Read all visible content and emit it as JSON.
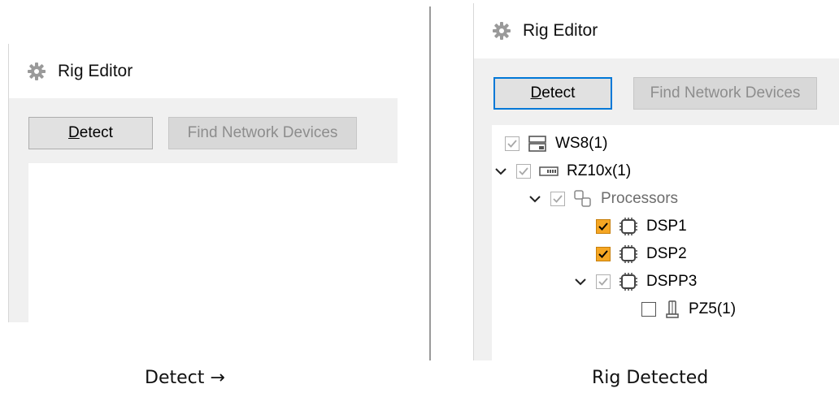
{
  "left": {
    "title": "Rig Editor",
    "detect_button": {
      "accel": "D",
      "rest": "etect"
    },
    "find_button": "Find Network Devices",
    "caption": "Detect →"
  },
  "right": {
    "title": "Rig Editor",
    "detect_button": {
      "accel": "D",
      "rest": "etect"
    },
    "find_button": "Find Network Devices",
    "caption": "Rig Detected",
    "tree": [
      {
        "label": "WS8(1)",
        "icon": "workstation-icon",
        "checkbox": "grey-checked",
        "expanded": null
      },
      {
        "label": "RZ10x(1)",
        "icon": "rack-device-icon",
        "checkbox": "grey-checked",
        "expanded": true
      },
      {
        "label": "Processors",
        "icon": "processors-group-icon",
        "checkbox": "grey-checked",
        "expanded": true
      },
      {
        "label": "DSP1",
        "icon": "processor-chip-icon",
        "checkbox": "checked",
        "expanded": null
      },
      {
        "label": "DSP2",
        "icon": "processor-chip-icon",
        "checkbox": "checked",
        "expanded": null
      },
      {
        "label": "DSPP3",
        "icon": "processor-chip-icon",
        "checkbox": "grey-checked",
        "expanded": true
      },
      {
        "label": "PZ5(1)",
        "icon": "amplifier-icon",
        "checkbox": "unchecked",
        "expanded": null
      }
    ]
  },
  "colors": {
    "accent": "#0078d7",
    "checked_orange": "#f5a623",
    "panel_bg": "#f0f0f0"
  }
}
